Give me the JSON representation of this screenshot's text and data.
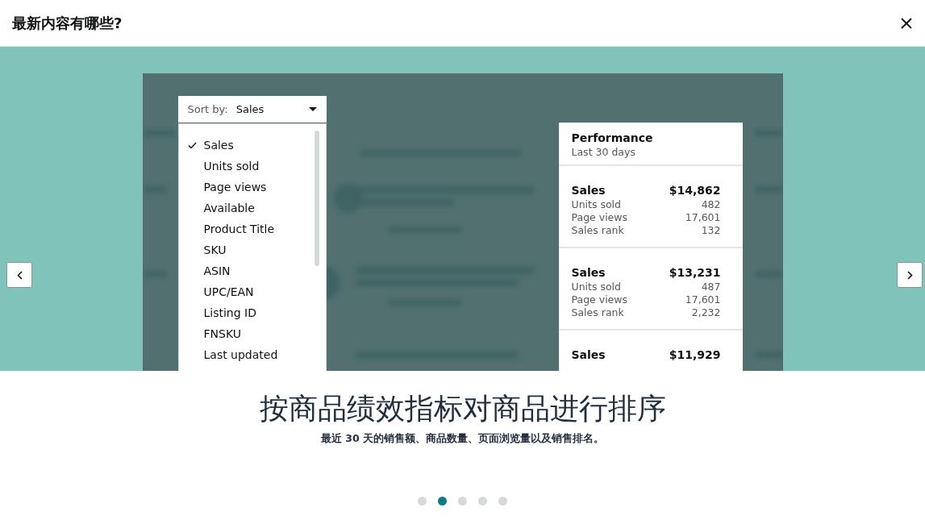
{
  "dialog": {
    "title": "最新内容有哪些?"
  },
  "slide": {
    "sort": {
      "label": "Sort by:",
      "value": "Sales",
      "options": [
        {
          "label": "Sales",
          "selected": true
        },
        {
          "label": "Units sold",
          "selected": false
        },
        {
          "label": "Page views",
          "selected": false
        },
        {
          "label": "Available",
          "selected": false
        },
        {
          "label": "Product Title",
          "selected": false
        },
        {
          "label": "SKU",
          "selected": false
        },
        {
          "label": "ASIN",
          "selected": false
        },
        {
          "label": "UPC/EAN",
          "selected": false
        },
        {
          "label": "Listing ID",
          "selected": false
        },
        {
          "label": "FNSKU",
          "selected": false
        },
        {
          "label": "Last updated",
          "selected": false
        }
      ]
    },
    "performance": {
      "title": "Performance",
      "subtitle": "Last 30 days",
      "items": [
        {
          "metric": "Sales",
          "value": "$14,862",
          "rows": [
            {
              "label": "Units sold",
              "value": "482"
            },
            {
              "label": "Page views",
              "value": "17,601"
            },
            {
              "label": "Sales rank",
              "value": "132"
            }
          ]
        },
        {
          "metric": "Sales",
          "value": "$13,231",
          "rows": [
            {
              "label": "Units sold",
              "value": "487"
            },
            {
              "label": "Page views",
              "value": "17,601"
            },
            {
              "label": "Sales rank",
              "value": "2,232"
            }
          ]
        },
        {
          "metric": "Sales",
          "value": "$11,929"
        }
      ]
    }
  },
  "caption": {
    "heading": "按商品绩效指标对商品进行排序",
    "text": "最近 30 天的销售额、商品数量、页面浏览量以及销售排名。"
  },
  "pager": [
    {
      "selected": false
    },
    {
      "selected": true
    },
    {
      "selected": false
    },
    {
      "selected": false
    },
    {
      "selected": false
    }
  ]
}
